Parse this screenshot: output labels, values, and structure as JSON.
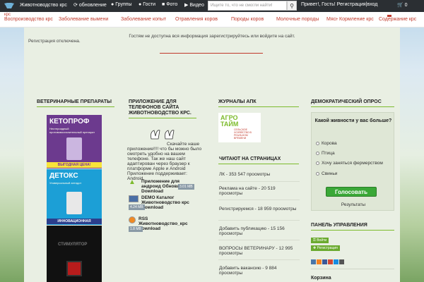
{
  "topbar": {
    "site_title": "Животноводство крс",
    "links": [
      "обновление",
      "Группы",
      "Гости",
      "Фото",
      "Видео"
    ],
    "search_placeholder": "Ищите то, что не смогли найти!",
    "greeting": "Привет!, Гость! Регистрация|вход",
    "cart_count": "0"
  },
  "menu": {
    "top_small": "крс",
    "items": [
      "Воспроизводство крс",
      "Заболевание вымени",
      "Заболевание копыт",
      "Отравления коров",
      "Породы коров",
      "Молочные породы",
      "Мясные породы",
      "Кормление крс",
      "Содержание крс"
    ]
  },
  "main": {
    "notice": "Гостям не доступна вся информация зарегистрируйтесь или войдите на сайт.",
    "registration_disabled": "Регистрация отключена."
  },
  "col1": {
    "title": "ВЕТЕРИНАРНЫЕ ПРЕПАРАТЫ",
    "ads": [
      {
        "title": "КЕТОПРОФ",
        "subtitle": "Нестероидный противовоспалительный препарат",
        "tag": "ВЫГОДНАЯ ЦЕНА!"
      },
      {
        "title": "ДЕТОКС",
        "subtitle": "Универсальный антидот",
        "tag": "ИННОВАЦИОННАЯ РАЗРАБОТКА"
      },
      {
        "title": "СТИМУЛЯТОР",
        "subtitle": "",
        "tag": ""
      }
    ]
  },
  "col2": {
    "title": "ПРИЛОЖЕНИЕ ДЛЯ ТЕЛЕФОНОВ САЙТА ЖИВОТНОВОДСТВО КРС.",
    "download_label": "Скачайте наше",
    "desc": "приложение!!!! что бы можно было смотреть удобно на вашем телефоне. Так же наш сайт адаптирован через браузер к платформе Apple и Android Приложение поддерживает: Android",
    "apps": [
      {
        "name": "Приложение для андроид Обновлено! Download",
        "size": "3.01 MB"
      },
      {
        "name": "DEMO Каталог Животноводство крс Download",
        "size": "4.24 MB"
      },
      {
        "name": "RSS Животноводство_крс Download",
        "size": "1.8 MB"
      }
    ]
  },
  "col3": {
    "title": "ЖУРНАЛЫ АПК",
    "agro_title": "АГРО ТАЙМ",
    "agro_sub": "СЕЛЬСКОЕ ХОЗЯЙСТВО В РЕАЛЬНОМ ВРЕМЕНИ",
    "reading_title": "ЧИТАЮТ НА СТРАНИЦАХ",
    "stats": [
      "ЛК    - 353 547 просмотры",
      "Реклама на сайте    - 20 519 просмотры",
      "Регистрируемся    - 18 959 просмотры",
      "Добавить публикацию    - 15 156 просмотры",
      "ВОПРОСЫ ВЕТЕРИНАРУ    - 12 995 просмотры",
      "Добавить вакансию    - 9 884 просмотры"
    ]
  },
  "col4": {
    "title": "ДЕМОКРАТИЧЕСКИЙ ОПРОС",
    "question": "Какой живности у вас больше?",
    "options": [
      "Корова",
      "Птица",
      "Хочу заняться фермерством",
      "Свиньи"
    ],
    "vote_label": "Голосовать",
    "results_label": "Результаты",
    "panel_title": "ПАНЕЛЬ УПРАВЛЕНИЯ",
    "login_label": "Войти",
    "register_label": "Регистрация",
    "cart_title": "Корзина"
  },
  "colors": {
    "topbar": "#2b2f33",
    "menu_text": "#c0392b",
    "accent_green": "#7dbb2c",
    "vote_button": "#3aa837"
  }
}
